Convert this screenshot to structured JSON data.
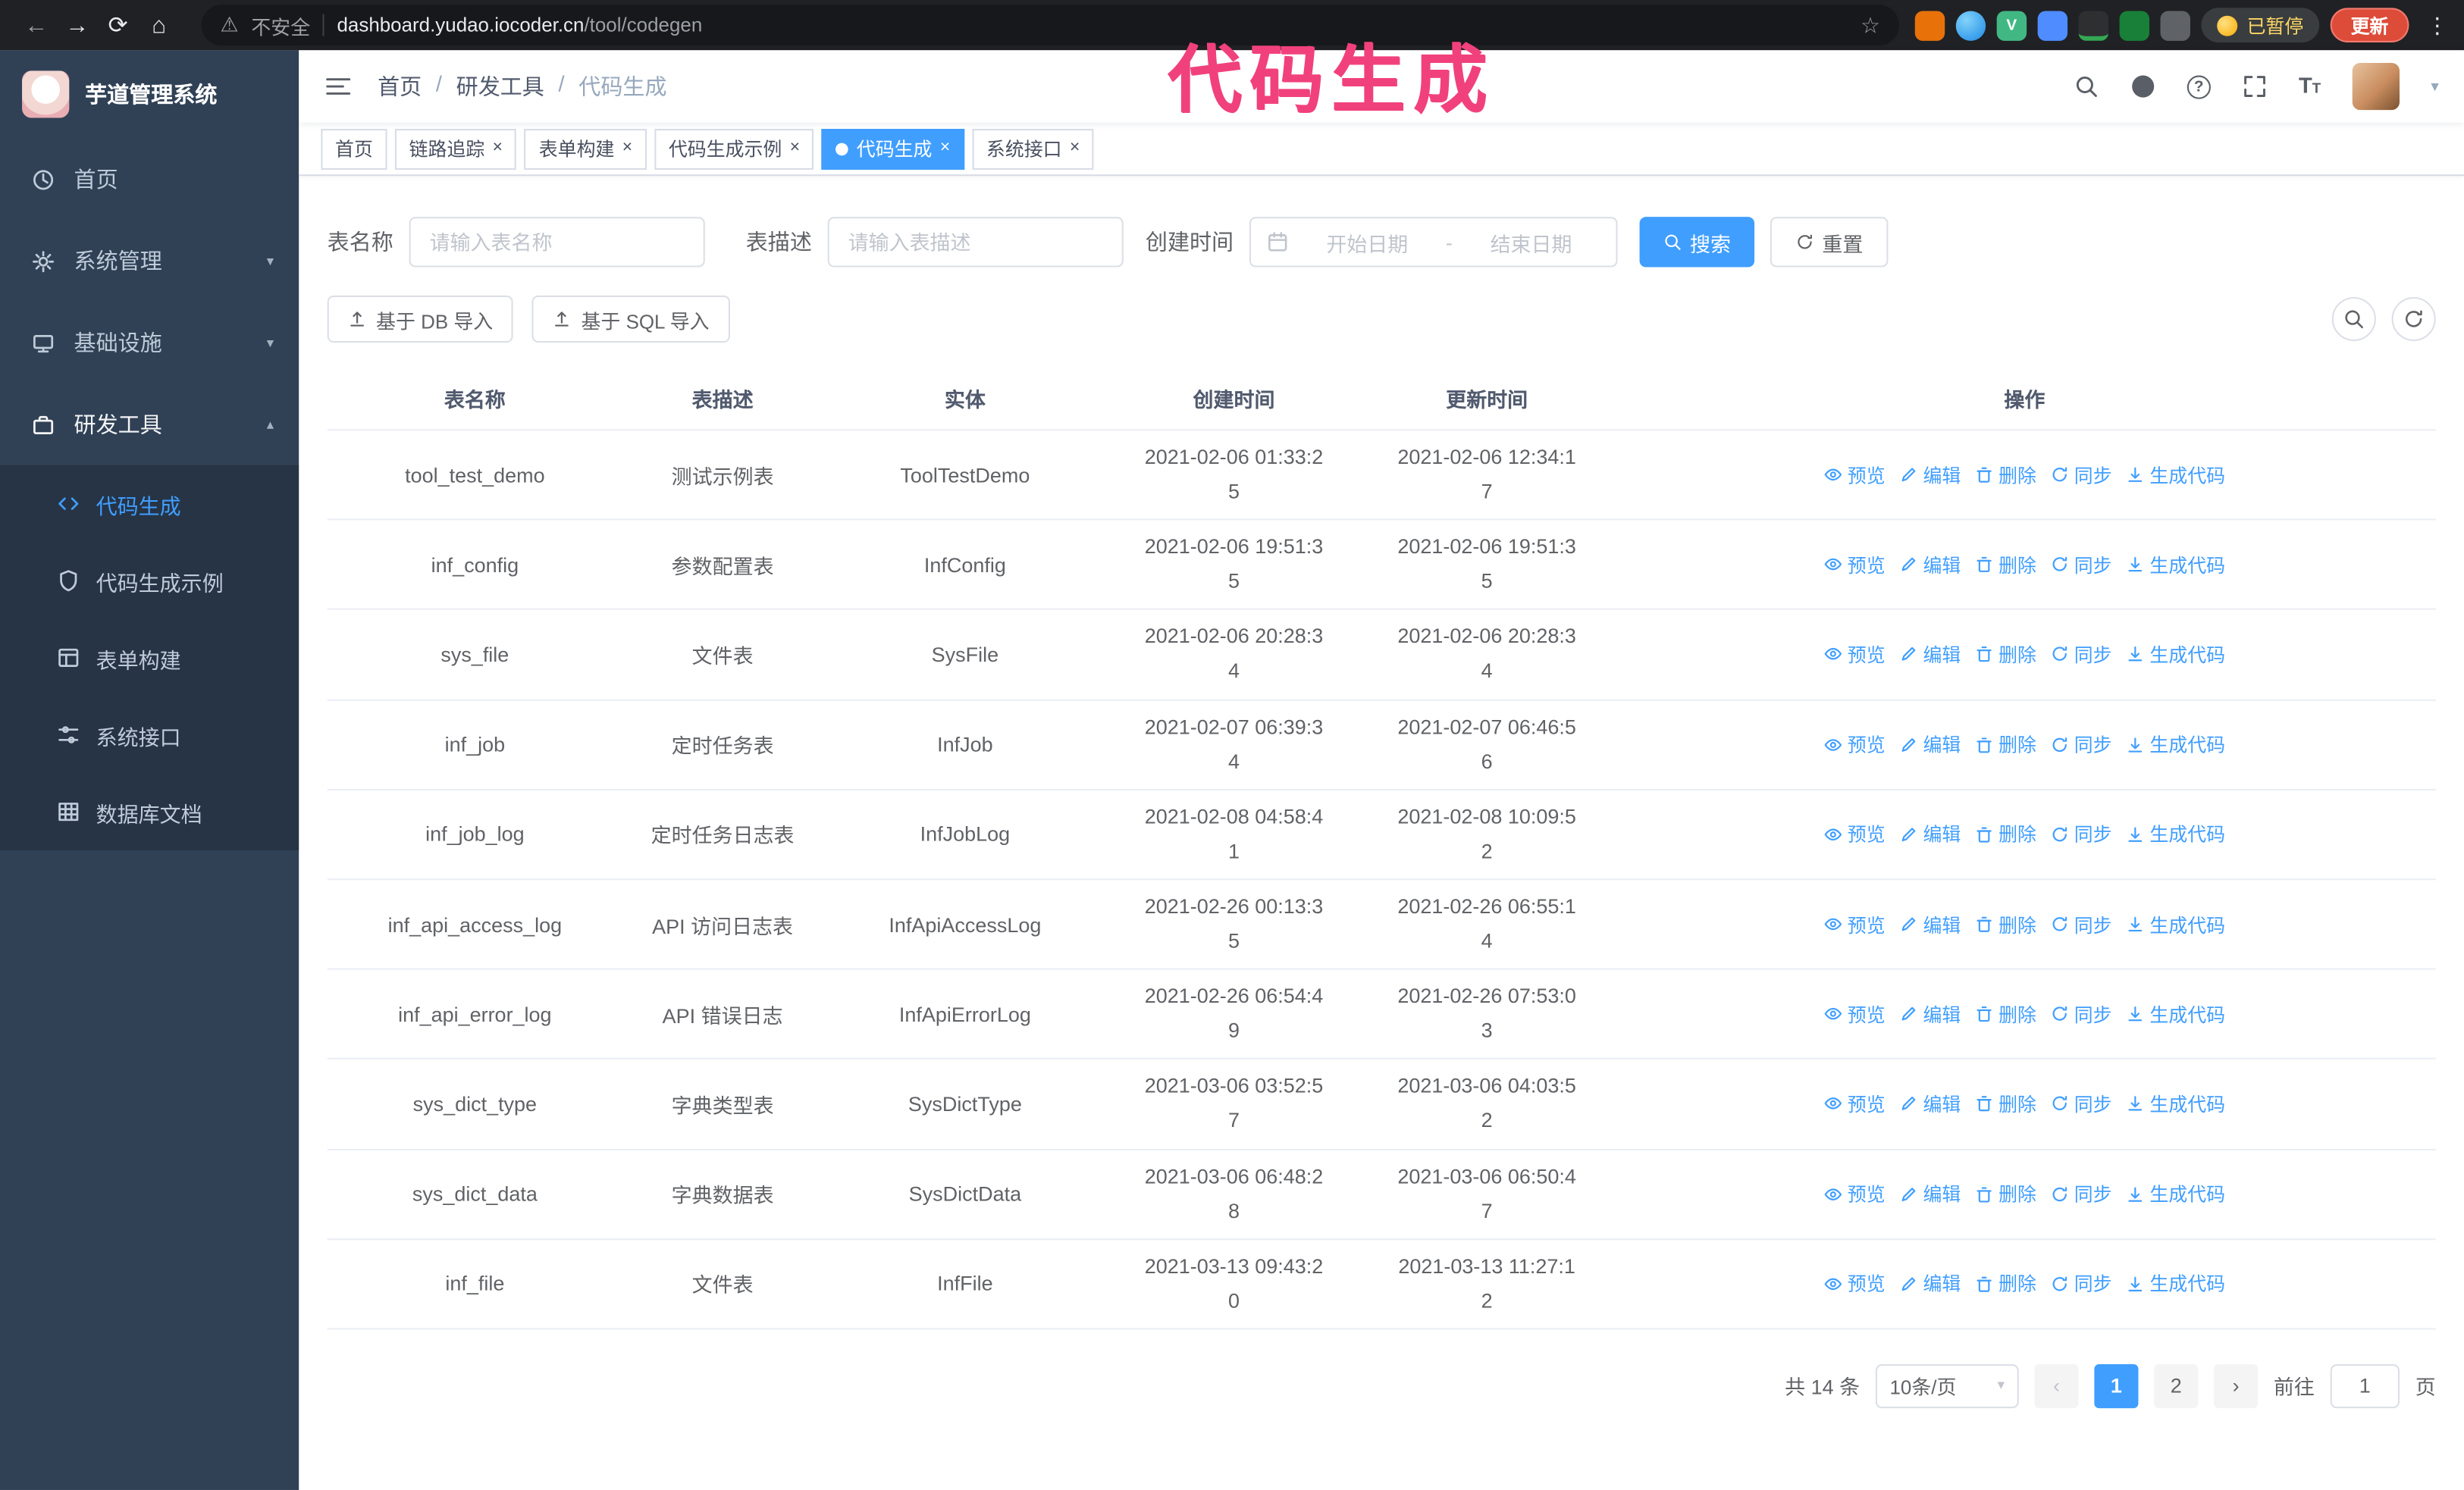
{
  "browser": {
    "security_warning": "不安全",
    "url_domain": "dashboard.yudao.iocoder.cn",
    "url_path": "/tool/codegen",
    "paused_label": "已暂停",
    "update_label": "更新"
  },
  "annotation": {
    "text": "代码生成"
  },
  "icons": {
    "back": "←",
    "forward": "→",
    "reload": "⟳",
    "home": "⌂",
    "warning": "⚠",
    "star": "☆",
    "menu_dots": "⋮",
    "close": "×",
    "chevron_down": "▾",
    "chevron_up": "▴",
    "caret_down": "▾",
    "question": "?",
    "vue": "V",
    "t_large": "T",
    "t_small": "T",
    "prev": "‹",
    "next": "›",
    "select_caret": "▾"
  },
  "sidebar": {
    "logo_title": "芋道管理系统",
    "items": [
      {
        "label": "首页"
      },
      {
        "label": "系统管理"
      },
      {
        "label": "基础设施"
      },
      {
        "label": "研发工具"
      }
    ],
    "subitems": [
      {
        "label": "代码生成"
      },
      {
        "label": "代码生成示例"
      },
      {
        "label": "表单构建"
      },
      {
        "label": "系统接口"
      },
      {
        "label": "数据库文档"
      }
    ]
  },
  "header": {
    "breadcrumb": [
      "首页",
      "研发工具",
      "代码生成"
    ],
    "separator": "/"
  },
  "tabs": [
    {
      "label": "首页"
    },
    {
      "label": "链路追踪"
    },
    {
      "label": "表单构建"
    },
    {
      "label": "代码生成示例"
    },
    {
      "label": "代码生成"
    },
    {
      "label": "系统接口"
    }
  ],
  "filters": {
    "table_name_label": "表名称",
    "table_name_placeholder": "请输入表名称",
    "table_desc_label": "表描述",
    "table_desc_placeholder": "请输入表描述",
    "create_time_label": "创建时间",
    "date_start_placeholder": "开始日期",
    "date_separator": "-",
    "date_end_placeholder": "结束日期",
    "search_label": "搜索",
    "reset_label": "重置"
  },
  "toolbar": {
    "import_db_label": "基于 DB 导入",
    "import_sql_label": "基于 SQL 导入"
  },
  "table": {
    "columns": [
      "表名称",
      "表描述",
      "实体",
      "创建时间",
      "更新时间",
      "操作"
    ],
    "actions": [
      "预览",
      "编辑",
      "删除",
      "同步",
      "生成代码"
    ],
    "rows": [
      {
        "name": "tool_test_demo",
        "desc": "测试示例表",
        "entity": "ToolTestDemo",
        "created": "2021-02-06 01:33:25",
        "updated": "2021-02-06 12:34:17"
      },
      {
        "name": "inf_config",
        "desc": "参数配置表",
        "entity": "InfConfig",
        "created": "2021-02-06 19:51:35",
        "updated": "2021-02-06 19:51:35"
      },
      {
        "name": "sys_file",
        "desc": "文件表",
        "entity": "SysFile",
        "created": "2021-02-06 20:28:34",
        "updated": "2021-02-06 20:28:34"
      },
      {
        "name": "inf_job",
        "desc": "定时任务表",
        "entity": "InfJob",
        "created": "2021-02-07 06:39:34",
        "updated": "2021-02-07 06:46:56"
      },
      {
        "name": "inf_job_log",
        "desc": "定时任务日志表",
        "entity": "InfJobLog",
        "created": "2021-02-08 04:58:41",
        "updated": "2021-02-08 10:09:52"
      },
      {
        "name": "inf_api_access_log",
        "desc": "API 访问日志表",
        "entity": "InfApiAccessLog",
        "created": "2021-02-26 00:13:35",
        "updated": "2021-02-26 06:55:14"
      },
      {
        "name": "inf_api_error_log",
        "desc": "API 错误日志",
        "entity": "InfApiErrorLog",
        "created": "2021-02-26 06:54:49",
        "updated": "2021-02-26 07:53:03"
      },
      {
        "name": "sys_dict_type",
        "desc": "字典类型表",
        "entity": "SysDictType",
        "created": "2021-03-06 03:52:57",
        "updated": "2021-03-06 04:03:52"
      },
      {
        "name": "sys_dict_data",
        "desc": "字典数据表",
        "entity": "SysDictData",
        "created": "2021-03-06 06:48:28",
        "updated": "2021-03-06 06:50:47"
      },
      {
        "name": "inf_file",
        "desc": "文件表",
        "entity": "InfFile",
        "created": "2021-03-13 09:43:20",
        "updated": "2021-03-13 11:27:12"
      }
    ]
  },
  "pagination": {
    "total": "共 14 条",
    "page_size": "10条/页",
    "page_1": "1",
    "page_2": "2",
    "goto_prefix": "前往",
    "goto_value": "1",
    "goto_suffix": "页"
  },
  "colors": {
    "primary": "#409eff",
    "annotation": "#f1417c",
    "sidebar_bg": "#304156",
    "submenu_bg": "#263445"
  }
}
